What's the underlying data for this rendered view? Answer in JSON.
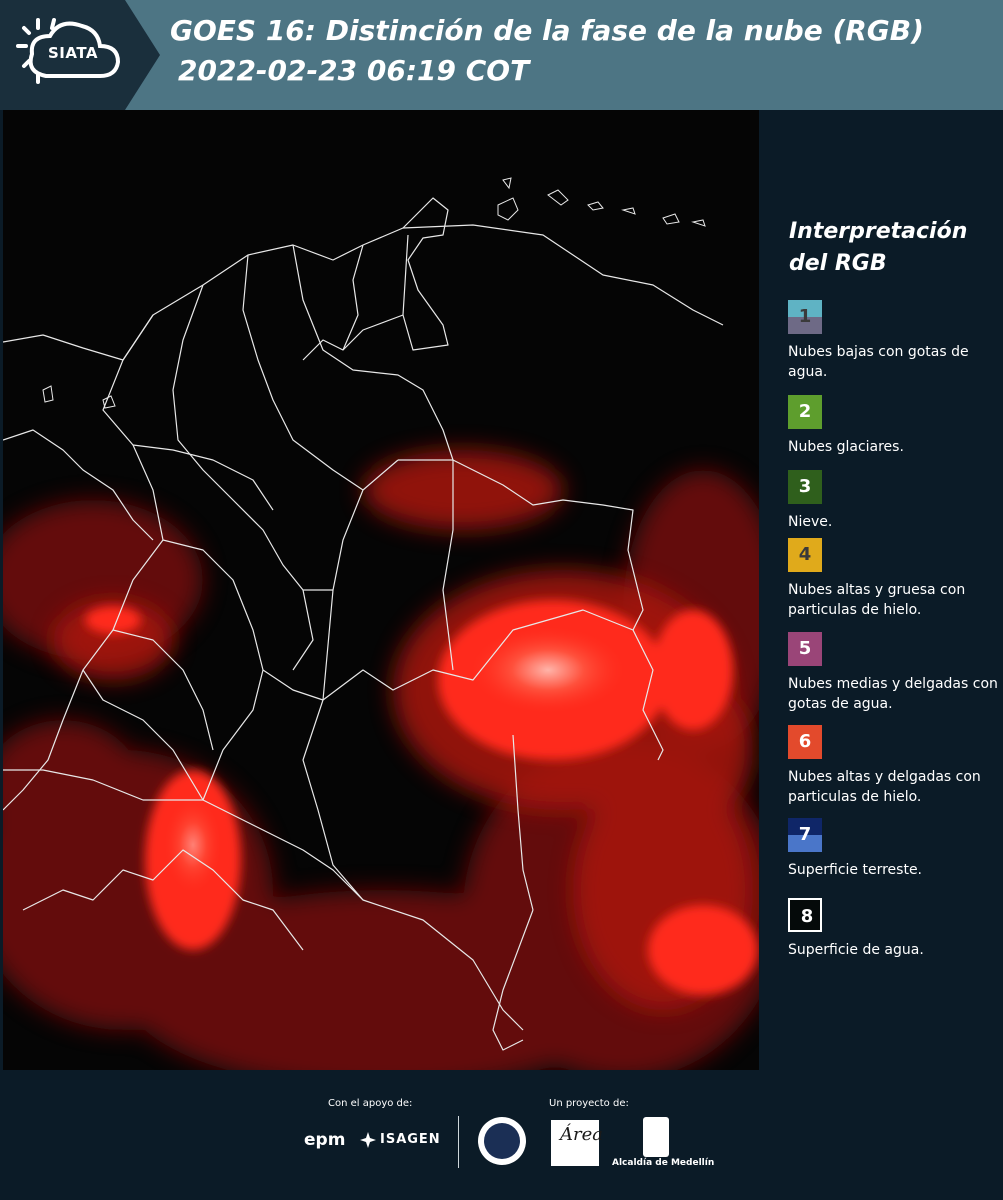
{
  "header": {
    "logo_text": "SIATA",
    "title_line1": "GOES 16: Distinción de la fase de la nube (RGB)",
    "title_line2": "2022-02-23 06:19 COT"
  },
  "legend": {
    "title": "Interpretación\ndel RGB",
    "items": [
      {
        "number": "1",
        "label": "Nubes bajas con gotas de agua.",
        "color_top": "#5fb3c4",
        "color_bottom": "#6e6a86"
      },
      {
        "number": "2",
        "label": "Nubes glaciares.",
        "color_top": "#5e9e2d",
        "color_bottom": "#5e9e2d"
      },
      {
        "number": "3",
        "label": "Nieve.",
        "color_top": "#2f5f1c",
        "color_bottom": "#2f5f1c"
      },
      {
        "number": "4",
        "label": "Nubes altas y gruesa con particulas de hielo.",
        "color_top": "#e0aa1b",
        "color_bottom": "#e0aa1b"
      },
      {
        "number": "5",
        "label": "Nubes medias y delgadas con gotas de agua.",
        "color_top": "#9a4578",
        "color_bottom": "#9a4578"
      },
      {
        "number": "6",
        "label": "Nubes altas y delgadas con particulas de hielo.",
        "color_top": "#e34a2c",
        "color_bottom": "#e34a2c"
      },
      {
        "number": "7",
        "label": "Superficie terreste.",
        "color_top": "#0f2668",
        "color_bottom": "#4a76c9"
      },
      {
        "number": "8",
        "label": "Superficie de agua.",
        "color_top": "#050a0a",
        "color_bottom": "#050a0a"
      }
    ]
  },
  "footer": {
    "support_label": "Con el apoyo de:",
    "project_label": "Un proyecto de:",
    "sponsor1": "epm",
    "sponsor2": "ISAGEN",
    "partner_area": "Área",
    "partner_alcaldia": "Alcaldía de Medellín"
  },
  "colors": {
    "header_bg": "#4d7584",
    "panel_bg": "#0b1b27",
    "cloud_red": "#ff2a1a"
  }
}
